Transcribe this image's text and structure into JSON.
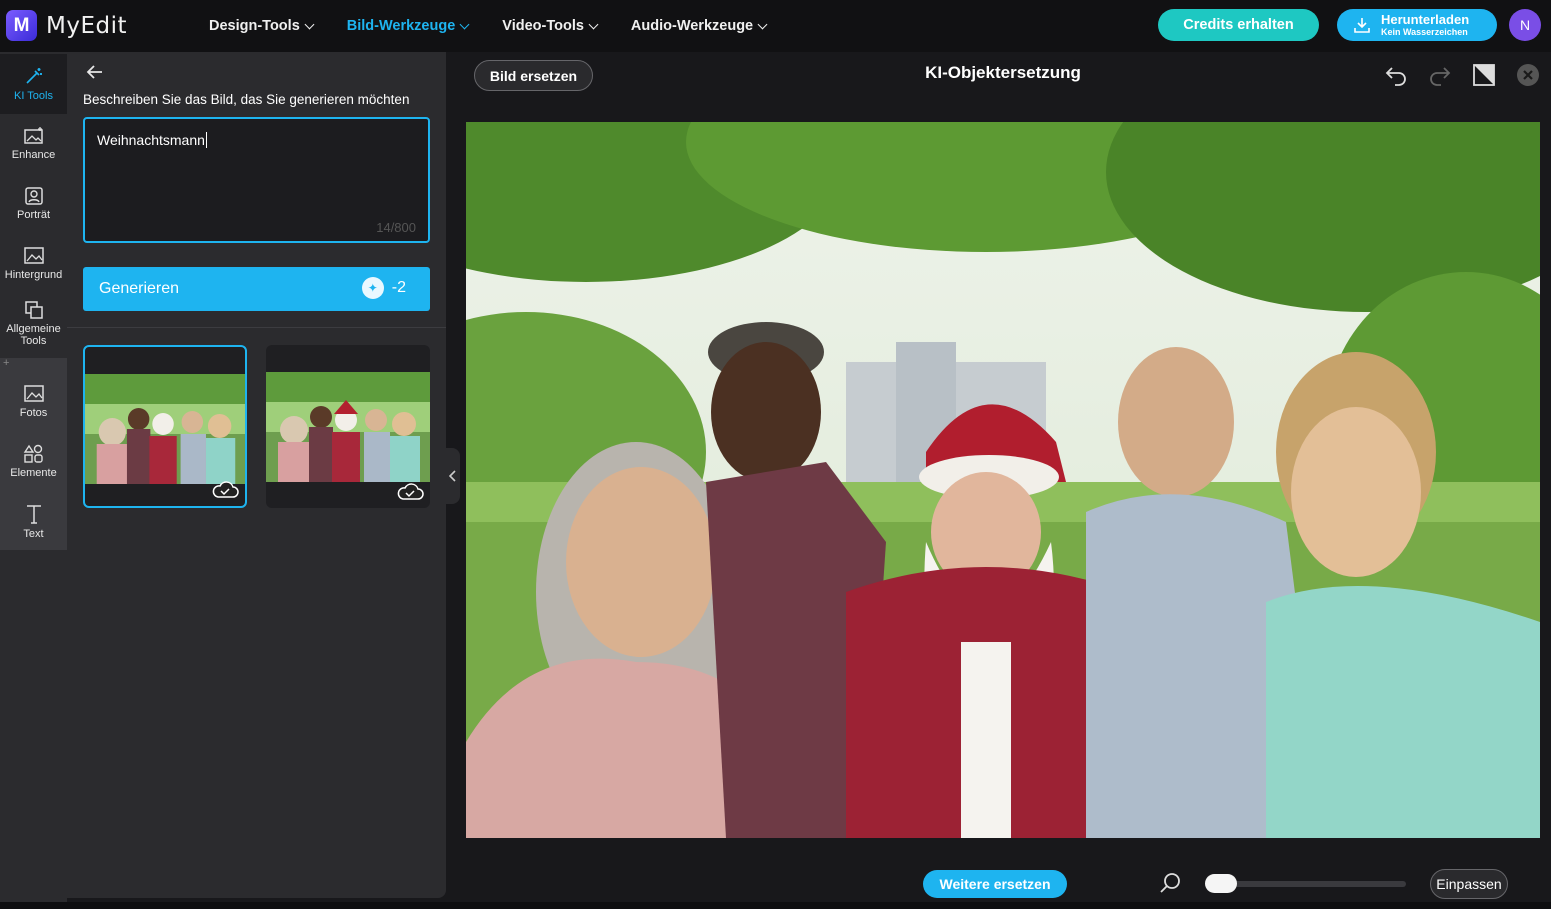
{
  "app": {
    "name": "MyEdit",
    "logo_letter": "M"
  },
  "nav": [
    {
      "label": "Design-Tools",
      "active": false
    },
    {
      "label": "Bild-Werkzeuge",
      "active": true
    },
    {
      "label": "Video-Tools",
      "active": false
    },
    {
      "label": "Audio-Werkzeuge",
      "active": false
    }
  ],
  "header": {
    "credits_label": "Credits erhalten",
    "download_label": "Herunterladen",
    "download_sub": "Kein Wasserzeichen",
    "avatar_initial": "N"
  },
  "rail": [
    {
      "label": "KI Tools",
      "icon": "magic-wand-icon",
      "active": true
    },
    {
      "label": "Enhance",
      "icon": "enhance-icon"
    },
    {
      "label": "Porträt",
      "icon": "portrait-icon"
    },
    {
      "label": "Hintergrund",
      "icon": "background-icon"
    },
    {
      "label": "Allgemeine Tools",
      "icon": "general-tools-icon"
    },
    {
      "label": "Fotos",
      "icon": "photos-icon"
    },
    {
      "label": "Elemente",
      "icon": "elements-icon"
    },
    {
      "label": "Text",
      "icon": "text-icon"
    }
  ],
  "panel": {
    "prompt_label": "Beschreiben Sie das Bild, das Sie generieren möchten",
    "prompt_value": "Weihnachtsmann",
    "counter": "14/800",
    "generate_label": "Generieren",
    "generate_cost": "-2"
  },
  "editor": {
    "replace_label": "Bild ersetzen",
    "title": "KI-Objektersetzung",
    "more_label": "Weitere ersetzen",
    "fit_label": "Einpassen"
  },
  "colors": {
    "accent": "#1eb4f0",
    "credits": "#1ec8c2",
    "avatar": "#7a4ee6"
  }
}
